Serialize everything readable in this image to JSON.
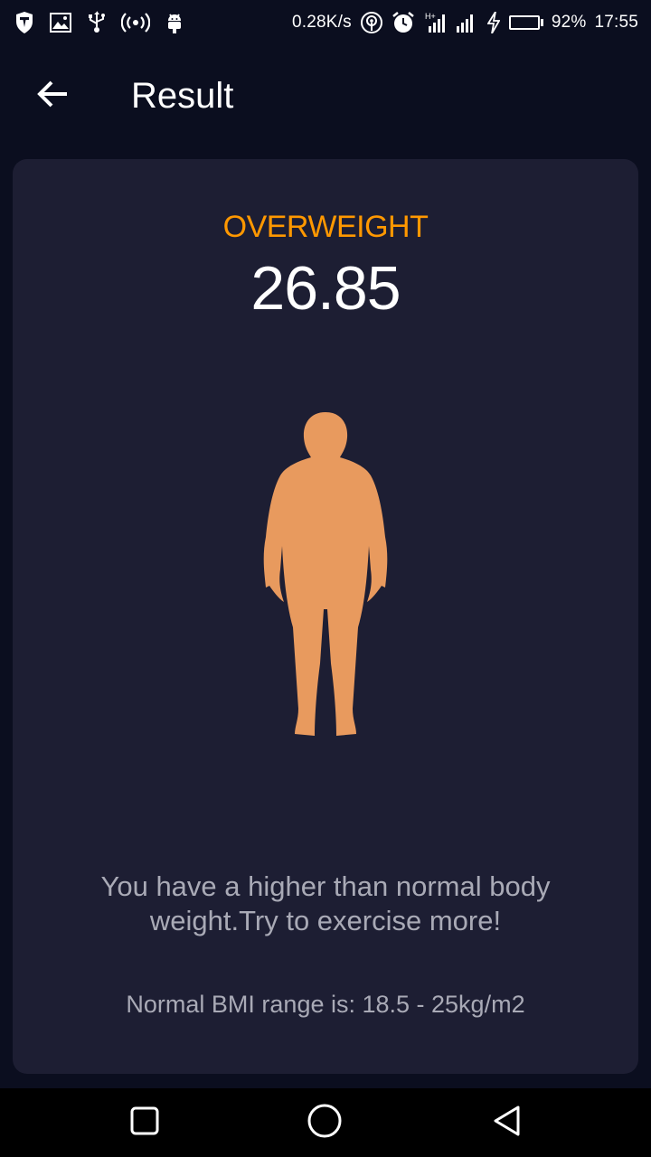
{
  "status_bar": {
    "network_speed": "0.28K/s",
    "battery_percent": "92%",
    "battery_level": 0.92,
    "time": "17:55",
    "icons": [
      "shield-icon",
      "image-icon",
      "usb-icon",
      "hotspot-icon",
      "android-icon",
      "wifi-hotspot-icon",
      "alarm-icon",
      "signal-icon",
      "signal-icon",
      "charging-icon",
      "battery-icon"
    ]
  },
  "app_bar": {
    "title": "Result",
    "back_icon": "arrow-left-icon"
  },
  "result": {
    "category": "OVERWEIGHT",
    "bmi": "26.85",
    "message": "You have a higher than normal body weight.Try to exercise more!",
    "range_text": "Normal BMI range is:  18.5 - 25kg/m2",
    "category_color": "#ff9800",
    "figure_color": "#e89a5e"
  },
  "nav_bar": {
    "icons": [
      "recents-square-icon",
      "home-circle-icon",
      "back-triangle-icon"
    ]
  },
  "colors": {
    "background": "#0b0e1f",
    "card": "#1d1e33",
    "muted_text": "#a9aab6"
  }
}
